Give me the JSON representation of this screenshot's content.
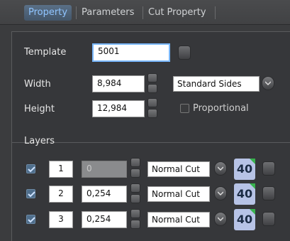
{
  "tabs": [
    {
      "label": "Property",
      "active": true
    },
    {
      "label": "Parameters",
      "active": false
    },
    {
      "label": "Cut Property",
      "active": false
    }
  ],
  "form": {
    "template_label": "Template",
    "template_value": "5001",
    "width_label": "Width",
    "width_value": "8,984",
    "height_label": "Height",
    "height_value": "12,984",
    "sides_select": "Standard Sides",
    "proportional_label": "Proportional",
    "proportional_checked": false
  },
  "layers": {
    "title": "Layers",
    "rows": [
      {
        "checked": true,
        "index": "1",
        "offset": "0",
        "offset_disabled": true,
        "cut": "Normal Cut",
        "badge": "40"
      },
      {
        "checked": true,
        "index": "2",
        "offset": "0,254",
        "offset_disabled": false,
        "cut": "Normal Cut",
        "badge": "40"
      },
      {
        "checked": true,
        "index": "3",
        "offset": "0,254",
        "offset_disabled": false,
        "cut": "Normal Cut",
        "badge": "40"
      }
    ]
  },
  "colors": {
    "accent": "#8fc4ff",
    "badge_bg": "#b7c3e6",
    "badge_corner": "#37b24d",
    "panel_bg": "#36373a"
  },
  "icons": {
    "template_browse": "square-button-icon",
    "dropdown": "chevron-down-icon",
    "checkbox": "check-icon"
  }
}
